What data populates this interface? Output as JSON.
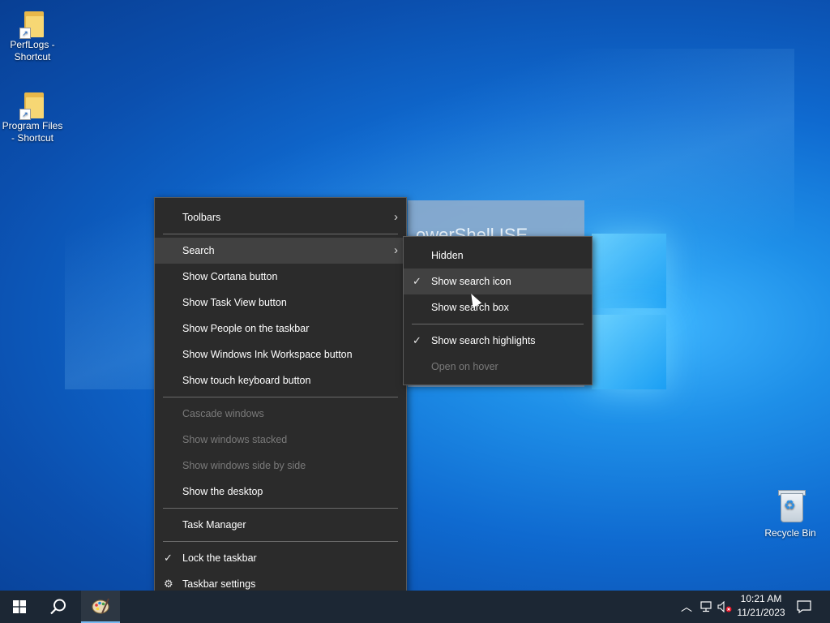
{
  "desktop": {
    "icons": [
      {
        "label": "PerfLogs - Shortcut"
      },
      {
        "label": "Program Files - Shortcut"
      },
      {
        "label": "Recycle Bin"
      }
    ],
    "background_window_text": "owerShell ISE"
  },
  "context_menu": {
    "items": {
      "toolbars": "Toolbars",
      "search": "Search",
      "cortana": "Show Cortana button",
      "task_view": "Show Task View button",
      "people": "Show People on the taskbar",
      "ink": "Show Windows Ink Workspace button",
      "touch_keyboard": "Show touch keyboard button",
      "cascade": "Cascade windows",
      "stacked": "Show windows stacked",
      "side_by_side": "Show windows side by side",
      "show_desktop": "Show the desktop",
      "task_manager": "Task Manager",
      "lock": "Lock the taskbar",
      "settings": "Taskbar settings"
    },
    "lock_checked": true
  },
  "search_submenu": {
    "hidden": "Hidden",
    "show_icon": "Show search icon",
    "show_box": "Show search box",
    "highlights": "Show search highlights",
    "open_hover": "Open on hover",
    "selected": "Show search icon"
  },
  "taskbar": {
    "time": "10:21 AM",
    "date": "11/21/2023"
  },
  "colors": {
    "menu_bg": "#2b2b2b",
    "menu_highlight": "#414141",
    "taskbar_bg": "#1c2734"
  }
}
